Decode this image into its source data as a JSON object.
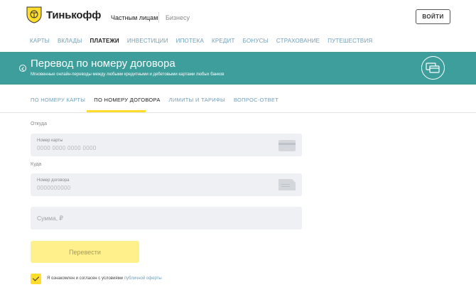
{
  "header": {
    "brand": "Тинькофф",
    "segment_private": "Частным лицам",
    "segment_business": "Бизнесу",
    "login_label": "ВОЙТИ"
  },
  "nav": {
    "items": [
      {
        "label": "КАРТЫ"
      },
      {
        "label": "ВКЛАДЫ"
      },
      {
        "label": "ПЛАТЕЖИ"
      },
      {
        "label": "ИНВЕСТИЦИИ"
      },
      {
        "label": "ИПОТЕКА"
      },
      {
        "label": "КРЕДИТ"
      },
      {
        "label": "БОНУСЫ"
      },
      {
        "label": "СТРАХОВАНИЕ"
      },
      {
        "label": "ПУТЕШЕСТВИЯ"
      }
    ],
    "active": "ПЛАТЕЖИ"
  },
  "banner": {
    "title": "Перевод по номеру договора",
    "subtitle": "Мгновенные онлайн-переводы между любыми кредитными и дебетовыми картами любых банков",
    "color": "#3d9e9b"
  },
  "subtabs": {
    "items": [
      {
        "label": "ПО НОМЕРУ КАРТЫ"
      },
      {
        "label": "ПО НОМЕРУ ДОГОВОРА"
      },
      {
        "label": "ЛИМИТЫ И ТАРИФЫ"
      },
      {
        "label": "ВОПРОС-ОТВЕТ"
      }
    ],
    "active": "ПО НОМЕРУ ДОГОВОРА"
  },
  "form": {
    "from_label": "Откуда",
    "card_field_label": "Номер карты",
    "card_placeholder": "0000 0000 0000 0000",
    "to_label": "Куда",
    "contract_field_label": "Номер договора",
    "contract_placeholder": "0000000000",
    "amount_placeholder": "Сумма, ₽",
    "submit_label": "Перевести",
    "agree_text": "Я ознакомлен и согласен с условиями",
    "agree_link": "публичной оферты",
    "agree_checked": true
  },
  "colors": {
    "accent_yellow": "#ffdd2d",
    "link_blue": "#6e9fbd"
  }
}
